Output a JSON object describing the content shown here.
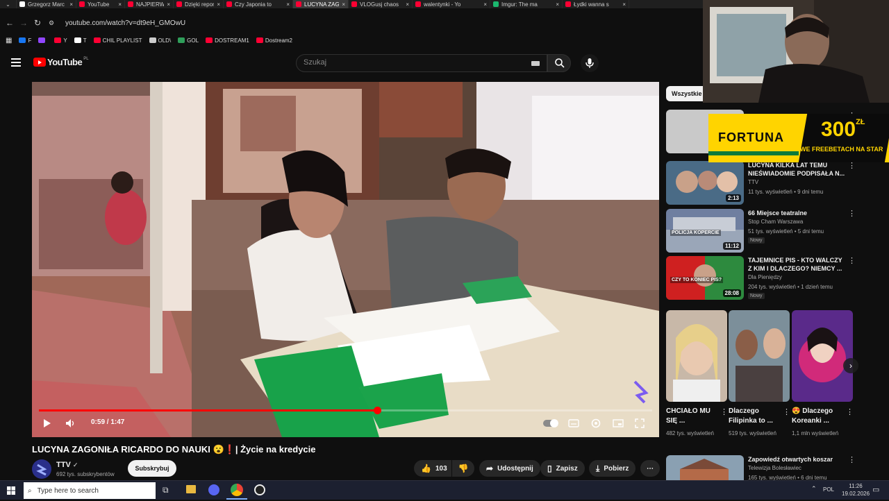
{
  "browser": {
    "tabs": [
      {
        "title": "Grzegorz Marc",
        "favicon_color": "#ffffff",
        "active": false
      },
      {
        "title": "YouTube",
        "favicon_color": "#ff0033",
        "active": false
      },
      {
        "title": "NAJPIERW STR",
        "favicon_color": "#ff0033",
        "active": false
      },
      {
        "title": "Dzięki reporte",
        "favicon_color": "#ff0033",
        "active": false
      },
      {
        "title": "Czy Japonia to",
        "favicon_color": "#ff0033",
        "active": false
      },
      {
        "title": "LUCYNA ZAGO",
        "favicon_color": "#ff0033",
        "active": true
      },
      {
        "title": "VLOGusj chaos",
        "favicon_color": "#ff0033",
        "active": false
      },
      {
        "title": "walentynki - Yo",
        "favicon_color": "#ff0033",
        "active": false
      },
      {
        "title": "Imgur: The ma",
        "favicon_color": "#1bb76e",
        "active": false
      },
      {
        "title": "Łydki wanna s",
        "favicon_color": "#ff0033",
        "active": false
      }
    ],
    "url": "youtube.com/watch?v=dt9eH_GMOwU",
    "bookmarks": [
      {
        "label": "F",
        "color": "#1877f2"
      },
      {
        "label": "",
        "color": "#9146ff"
      },
      {
        "label": "Y",
        "color": "#ff0033"
      },
      {
        "label": "T",
        "color": "#ffffff"
      },
      {
        "label": "CHIL PLAYLIST",
        "color": "#ff0033"
      },
      {
        "label": "OLD\\",
        "color": "#cccccc"
      },
      {
        "label": "GOL",
        "color": "#2f9e5a"
      },
      {
        "label": "DOSTREAM1",
        "color": "#ff0033"
      },
      {
        "label": "Dostream2",
        "color": "#ff0033"
      }
    ]
  },
  "youtube": {
    "logo_text": "YouTube",
    "logo_region": "PL",
    "search_placeholder": "Szukaj"
  },
  "player": {
    "time": "0:59 / 1:47",
    "progress": 0.551
  },
  "video": {
    "title": "LUCYNA ZAGONIŁA RICARDO DO NAUKI 😮❗| Życie na kredycie",
    "channel": "TTV",
    "subscribers": "692 tys. subskrybentów",
    "subscribe_label": "Subskrybuj",
    "likes": "103",
    "share_label": "Udostępnij",
    "save_label": "Zapisz",
    "download_label": "Pobierz"
  },
  "sidebar": {
    "chip_label": "Wszystkie",
    "recommendations": [
      {
        "title": "LUCYNA KILKA LAT TEMU NIEŚWIADOMIE PODPISAŁA N...",
        "channel": "TTV",
        "meta": "11 tys. wyświetleń • 9 dni temu",
        "duration": "2:13",
        "badge": ""
      },
      {
        "title": "66 Miejsce teatralne",
        "channel": "Stop Cham Warszawa",
        "meta": "51 tys. wyświetleń • 5 dni temu",
        "duration": "11:12",
        "badge": "Nowy",
        "thumb_text": "POLICJA KOPERCIE"
      },
      {
        "title": "TAJEMNICE PIS - KTO WALCZY Z KIM I DLACZEGO? NIEMCY ...",
        "channel": "Dla Pieniędzy",
        "meta": "204 tys. wyświetleń • 1 dzień temu",
        "duration": "28:08",
        "badge": "Nowy",
        "thumb_text": "CZY TO KONIEC PIS?"
      },
      {
        "title": "Zapowiedź otwartych koszar",
        "channel": "Telewizja Bolesławiec",
        "meta": "165 tys. wyświetleń • 6 dni temu",
        "duration": "",
        "badge": ""
      }
    ],
    "shorts": [
      {
        "title": "CHCIAŁO MU SIĘ ...",
        "views": "482 tys. wyświetleń"
      },
      {
        "title": "Dlaczego Filipinka to ...",
        "views": "519 tys. wyświetleń"
      },
      {
        "title": "😍 Dlaczego Koreanki ...",
        "views": "1,1 mln wyświetleń"
      }
    ]
  },
  "overlay": {
    "sponsor_name": "FORTUNA",
    "sponsor_amount": "300",
    "sponsor_currency": "ZŁ",
    "sponsor_tagline": "WE FREEBETACH NA STAR"
  },
  "taskbar": {
    "search_placeholder": "Type here to search",
    "language": "POL",
    "time": "11:26",
    "date": "19.02.2026"
  },
  "colors": {
    "background": "#0f0f0f",
    "accent_red": "#ff0000",
    "sponsor_yellow": "#ffd400",
    "sponsor_green": "#0b7a3b"
  }
}
